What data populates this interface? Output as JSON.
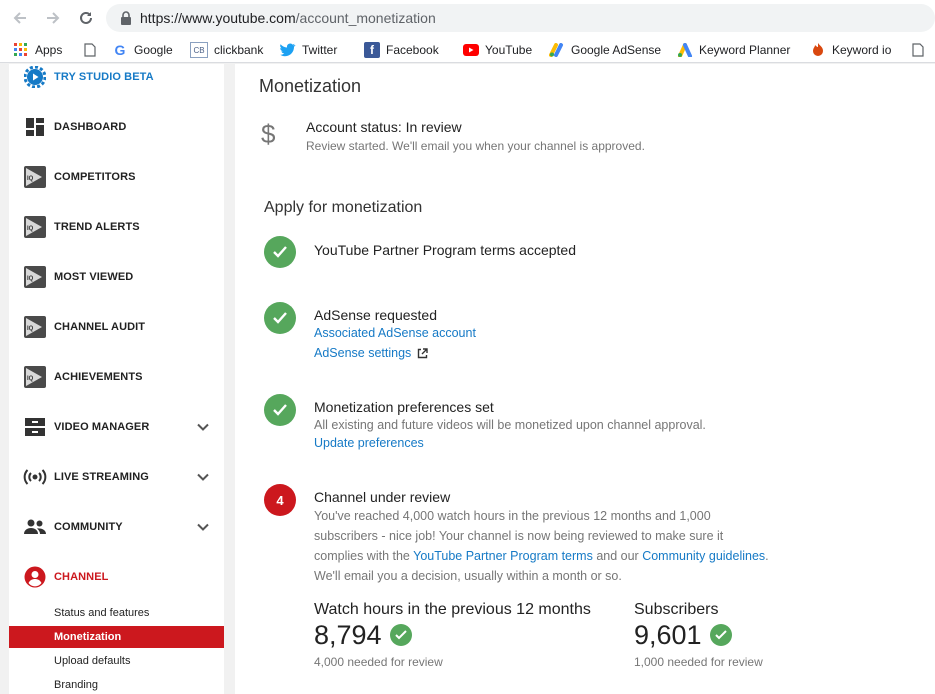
{
  "browser": {
    "url_host": "https://www.youtube.com",
    "url_path": "/account_monetization",
    "bookmarks": [
      {
        "label": "Apps",
        "icon": "apps-grid-icon"
      },
      {
        "label": "",
        "icon": "blank-page-icon"
      },
      {
        "label": "Google",
        "icon": "google-icon"
      },
      {
        "label": "clickbank",
        "icon": "clickbank-icon"
      },
      {
        "label": "Twitter",
        "icon": "twitter-icon"
      },
      {
        "label": "Facebook",
        "icon": "facebook-icon"
      },
      {
        "label": "YouTube",
        "icon": "youtube-icon"
      },
      {
        "label": "Google AdSense",
        "icon": "adsense-icon"
      },
      {
        "label": "Keyword Planner",
        "icon": "keyword-planner-icon"
      },
      {
        "label": "Keyword io",
        "icon": "keyword-io-icon"
      }
    ]
  },
  "sidebar": {
    "items": [
      {
        "label": "TRY STUDIO BETA",
        "icon": "studio-gear-icon"
      },
      {
        "label": "DASHBOARD",
        "icon": "dashboard-icon"
      },
      {
        "label": "COMPETITORS",
        "icon": "vidiq-icon"
      },
      {
        "label": "TREND ALERTS",
        "icon": "vidiq-icon"
      },
      {
        "label": "MOST VIEWED",
        "icon": "vidiq-icon"
      },
      {
        "label": "CHANNEL AUDIT",
        "icon": "vidiq-icon"
      },
      {
        "label": "ACHIEVEMENTS",
        "icon": "vidiq-icon"
      },
      {
        "label": "VIDEO MANAGER",
        "icon": "video-manager-icon"
      },
      {
        "label": "LIVE STREAMING",
        "icon": "live-streaming-icon"
      },
      {
        "label": "COMMUNITY",
        "icon": "community-icon"
      },
      {
        "label": "CHANNEL",
        "icon": "channel-user-icon"
      }
    ],
    "channel_subitems": [
      "Status and features",
      "Monetization",
      "Upload defaults",
      "Branding"
    ]
  },
  "main": {
    "title": "Monetization",
    "account_status": {
      "title": "Account status: In review",
      "subtitle": "Review started. We'll email you when your channel is approved."
    },
    "apply_heading": "Apply for monetization",
    "steps": {
      "terms": {
        "title": "YouTube Partner Program terms accepted"
      },
      "adsense": {
        "title": "AdSense requested",
        "link1": "Associated AdSense account",
        "link2": "AdSense settings"
      },
      "prefs": {
        "title": "Monetization preferences set",
        "text": "All existing and future videos will be monetized upon channel approval.",
        "link": "Update preferences"
      },
      "review": {
        "number": "4",
        "title": "Channel under review",
        "line1": "You've reached 4,000 watch hours in the previous 12 months and 1,000",
        "line2": "subscribers - nice job! Your channel is now being reviewed to make sure it",
        "line3_pre": "complies with the ",
        "line3_link1": "YouTube Partner Program terms",
        "line3_mid": " and our ",
        "line3_link2": "Community guidelines",
        "line3_post": ".",
        "line4": "We'll email you a decision, usually within a month or so."
      }
    },
    "metrics": {
      "watch_hours": {
        "label": "Watch hours in the previous 12 months",
        "value": "8,794",
        "note": "4,000 needed for review"
      },
      "subscribers": {
        "label": "Subscribers",
        "value": "9,601",
        "note": "1,000 needed for review"
      }
    }
  },
  "colors": {
    "accent_red": "#cc181e",
    "link_blue": "#167ac6",
    "check_green": "#56a75c"
  }
}
